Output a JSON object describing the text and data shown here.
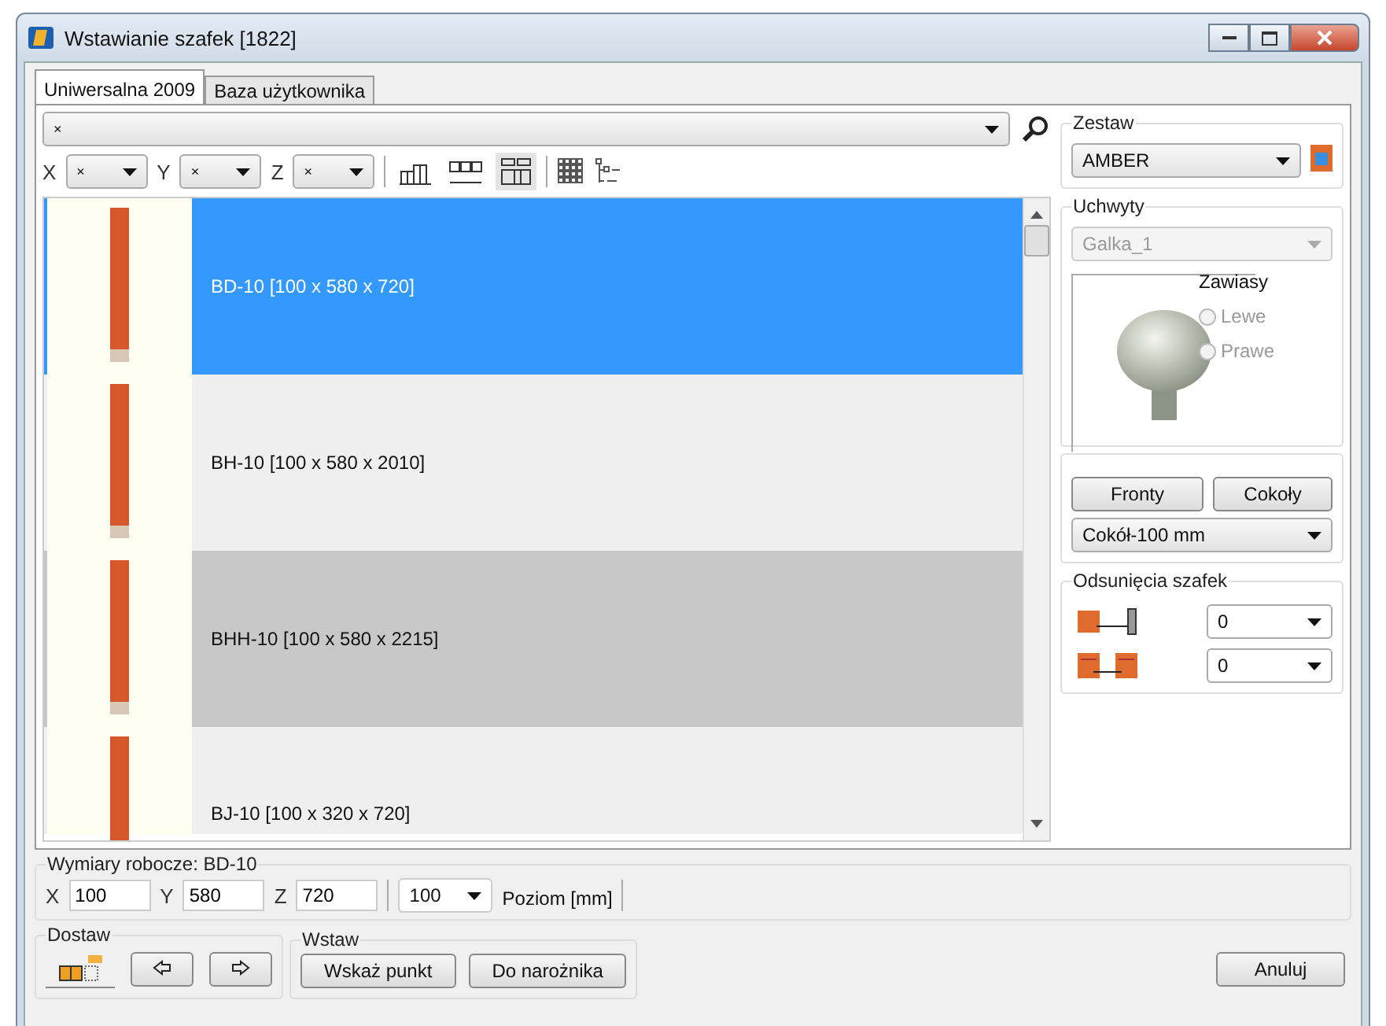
{
  "window": {
    "title": "Wstawianie szafek [1822]"
  },
  "tabs": [
    {
      "label": "Uniwersalna 2009",
      "selected": true
    },
    {
      "label": "Baza użytkownika",
      "selected": false
    }
  ],
  "filter": {
    "value": "×"
  },
  "axes": [
    {
      "label": "X",
      "value": "×"
    },
    {
      "label": "Y",
      "value": "×"
    },
    {
      "label": "Z",
      "value": "×"
    }
  ],
  "items": [
    {
      "label": "BD-10  [100 x 580 x 720]",
      "selected": true,
      "highlighted": false
    },
    {
      "label": "BH-10  [100 x 580 x 2010]",
      "selected": false,
      "highlighted": false
    },
    {
      "label": "BHH-10  [100 x 580 x 2215]",
      "selected": false,
      "highlighted": true
    },
    {
      "label": "BJ-10  [100 x 320 x 720]",
      "selected": false,
      "highlighted": false
    }
  ],
  "set": {
    "label": "Zestaw",
    "value": "AMBER"
  },
  "handles": {
    "label": "Uchwyty",
    "value": "Galka_1",
    "disabled": true,
    "hinges_label": "Zawiasy",
    "hinges": [
      {
        "label": "Lewe",
        "selected": false,
        "disabled": true
      },
      {
        "label": "Prawe",
        "selected": false,
        "disabled": true
      }
    ]
  },
  "fronts_button": "Fronty",
  "plinths_button": "Cokoły",
  "plinth": {
    "value": "Cokół-100 mm"
  },
  "offsets": {
    "label": "Odsunięcia szafek",
    "rows": [
      {
        "kind": "wall",
        "value": "0"
      },
      {
        "kind": "cabinet",
        "value": "0"
      }
    ]
  },
  "dimensions": {
    "label": "Wymiary robocze: BD-10",
    "fields": [
      {
        "axis": "X",
        "value": "100"
      },
      {
        "axis": "Y",
        "value": "580"
      },
      {
        "axis": "Z",
        "value": "720"
      }
    ],
    "level": {
      "value": "100",
      "label": "Poziom [mm]"
    }
  },
  "attach": {
    "label": "Dostaw"
  },
  "insert": {
    "label": "Wstaw",
    "buttons": [
      "Wskaż punkt",
      "Do narożnika"
    ]
  },
  "cancel_button": "Anuluj"
}
